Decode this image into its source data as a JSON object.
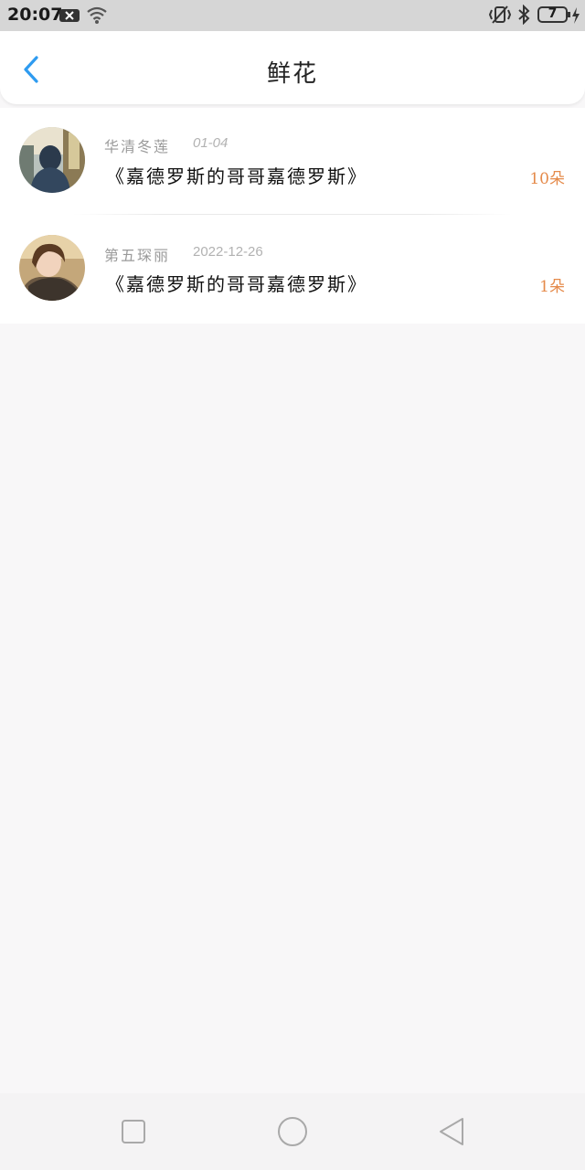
{
  "status_bar": {
    "time": "20:07",
    "battery": "7"
  },
  "header": {
    "title": "鲜花"
  },
  "list": [
    {
      "name": "华清冬莲",
      "date": "01-04",
      "work": "《嘉德罗斯的哥哥嘉德罗斯》",
      "count": "10朵"
    },
    {
      "name": "第五琛丽",
      "date": "2022-12-26",
      "work": "《嘉德罗斯的哥哥嘉德罗斯》",
      "count": "1朵"
    }
  ],
  "colors": {
    "accent_blue": "#2e9bf0",
    "count_orange": "#e58a4a"
  },
  "icons": [
    "back-arrow-icon",
    "notification-x-icon",
    "wifi-icon",
    "vibrate-icon",
    "bluetooth-icon",
    "battery-icon",
    "charging-icon",
    "square-nav-icon",
    "circle-nav-icon",
    "triangle-back-nav-icon"
  ]
}
